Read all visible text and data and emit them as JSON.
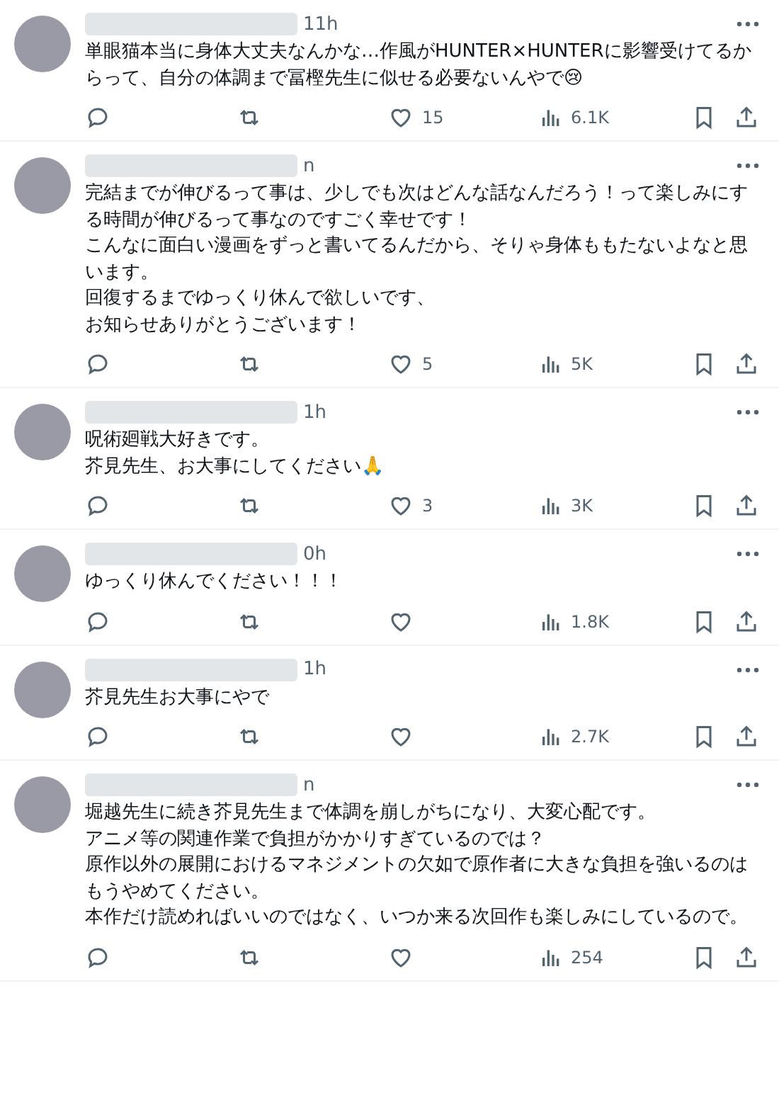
{
  "replies": [
    {
      "time": "11h",
      "lines": [
        "単眼猫本当に身体大丈夫なんかな…作風がHUNTER×HUNTERに影響受けてるからって、自分の体調まで冨樫先生に似せる必要ないんやで😢"
      ],
      "likes": "15",
      "views": "6.1K"
    },
    {
      "time": "n",
      "lines": [
        "完結までが伸びるって事は、少しでも次はどんな話なんだろう！って楽しみにする時間が伸びるって事なのですごく幸せです！",
        "こんなに面白い漫画をずっと書いてるんだから、そりゃ身体ももたないよなと思います。",
        "回復するまでゆっくり休んで欲しいです、",
        "お知らせありがとうございます！"
      ],
      "likes": "5",
      "views": "5K"
    },
    {
      "time": "1h",
      "lines": [
        "呪術廻戦大好きです。",
        "芥見先生、お大事にしてください🙏"
      ],
      "likes": "3",
      "views": "3K"
    },
    {
      "time": "0h",
      "lines": [
        "ゆっくり休んでください！！！"
      ],
      "views": "1.8K"
    },
    {
      "time": "1h",
      "lines": [
        "芥見先生お大事にやで"
      ],
      "views": "2.7K"
    },
    {
      "time": "n",
      "lines": [
        "堀越先生に続き芥見先生まで体調を崩しがちになり、大変心配です。",
        "アニメ等の関連作業で負担がかかりすぎているのでは？",
        "原作以外の展開におけるマネジメントの欠如で原作者に大きな負担を強いるのはもうやめてください。",
        "本作だけ読めればいいのではなく、いつか来る次回作も楽しみにしているので。"
      ],
      "views": "254"
    }
  ]
}
